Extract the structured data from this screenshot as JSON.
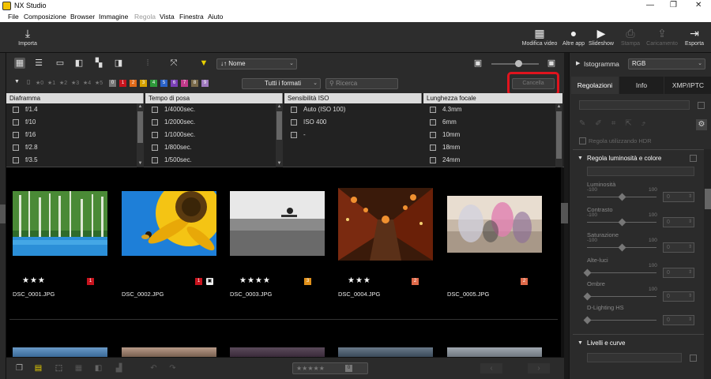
{
  "app": {
    "title": "NX Studio",
    "window_controls": [
      "—",
      "❐",
      "✕"
    ]
  },
  "menu": [
    "File",
    "Composizione",
    "Browser",
    "Immagine",
    "Regola",
    "Vista",
    "Finestra",
    "Aiuto"
  ],
  "toolbar": {
    "import": "Importa",
    "buttons": [
      {
        "label": "Modifica video",
        "icon": "video-edit-icon",
        "enabled": true
      },
      {
        "label": "Altre app",
        "icon": "app-icon",
        "enabled": true
      },
      {
        "label": "Slideshow",
        "icon": "slideshow-icon",
        "enabled": true
      },
      {
        "label": "Stampa",
        "icon": "print-icon",
        "enabled": false
      },
      {
        "label": "Caricamento",
        "icon": "upload-icon",
        "enabled": false
      },
      {
        "label": "Esporta",
        "icon": "export-icon",
        "enabled": true
      }
    ]
  },
  "viewbar": {
    "sort_label": "Nome",
    "sort_prefix": "↓↑"
  },
  "filterbar": {
    "stars": [
      "★0",
      "★1",
      "★2",
      "★3",
      "★4",
      "★5"
    ],
    "color_labels": [
      {
        "n": "0",
        "color": "#777777"
      },
      {
        "n": "1",
        "color": "#c8141e"
      },
      {
        "n": "2",
        "color": "#e06a1a"
      },
      {
        "n": "3",
        "color": "#d4a100"
      },
      {
        "n": "4",
        "color": "#2e9a3a"
      },
      {
        "n": "5",
        "color": "#2a62c8"
      },
      {
        "n": "6",
        "color": "#7a3fb5"
      },
      {
        "n": "7",
        "color": "#c23a8a"
      },
      {
        "n": "8",
        "color": "#7a6a4a"
      },
      {
        "n": "9",
        "color": "#a07abf"
      }
    ],
    "format": "Tutti i formati",
    "search_placeholder": "Ricerca",
    "cancel": "Cancella"
  },
  "filter_table": {
    "columns": [
      {
        "header": "Diaframma",
        "items": [
          "f/1.4",
          "f/10",
          "f/16",
          "f/2.8",
          "f/3.5"
        ]
      },
      {
        "header": "Tempo di posa",
        "items": [
          "1/4000sec.",
          "1/2000sec.",
          "1/1000sec.",
          "1/800sec.",
          "1/500sec."
        ]
      },
      {
        "header": "Sensibilità ISO",
        "items": [
          "Auto (ISO 100)",
          "ISO 400",
          "-"
        ]
      },
      {
        "header": "Lunghezza focale",
        "items": [
          "4.3mm",
          "6mm",
          "10mm",
          "18mm",
          "24mm"
        ]
      }
    ]
  },
  "thumbnails": [
    {
      "file": "DSC_0001.JPG",
      "stars": "★★★",
      "label": "1",
      "label_color": "#c8141e"
    },
    {
      "file": "DSC_0002.JPG",
      "stars": "",
      "label": "1",
      "label_color": "#c8141e",
      "overlay": true
    },
    {
      "file": "DSC_0003.JPG",
      "stars": "★★★★",
      "label": "3",
      "label_color": "#e0901a"
    },
    {
      "file": "DSC_0004.JPG",
      "stars": "★★★",
      "label": "2",
      "label_color": "#e06a4a"
    },
    {
      "file": "DSC_0005.JPG",
      "stars": "",
      "label": "2",
      "label_color": "#e06a4a"
    }
  ],
  "bottom": {
    "rating": "★★★★★",
    "rating_zero": "0"
  },
  "right_panel": {
    "histogram": {
      "title": "Istogramma",
      "channel": "RGB"
    },
    "tabs": [
      "Regolazioni",
      "Info",
      "XMP/IPTC"
    ],
    "hdr_label": "Regola utilizzando HDR",
    "section_title": "Regola luminosità e colore",
    "sliders": [
      {
        "label": "Luminosità",
        "min": "-100",
        "max": "100",
        "value": "0",
        "has_range": true
      },
      {
        "label": "Contrasto",
        "min": "-100",
        "max": "100",
        "value": "0",
        "has_range": true
      },
      {
        "label": "Saturazione",
        "min": "-100",
        "max": "100",
        "value": "0",
        "has_range": true
      },
      {
        "label": "Alte-luci",
        "min": "",
        "max": "100",
        "value": "0",
        "has_range": false
      },
      {
        "label": "Ombre",
        "min": "",
        "max": "100",
        "value": "0",
        "has_range": false
      },
      {
        "label": "D-Lighting HS",
        "min": "",
        "max": "",
        "value": "0",
        "has_range": false
      }
    ],
    "section2_title": "Livelli e curve"
  }
}
